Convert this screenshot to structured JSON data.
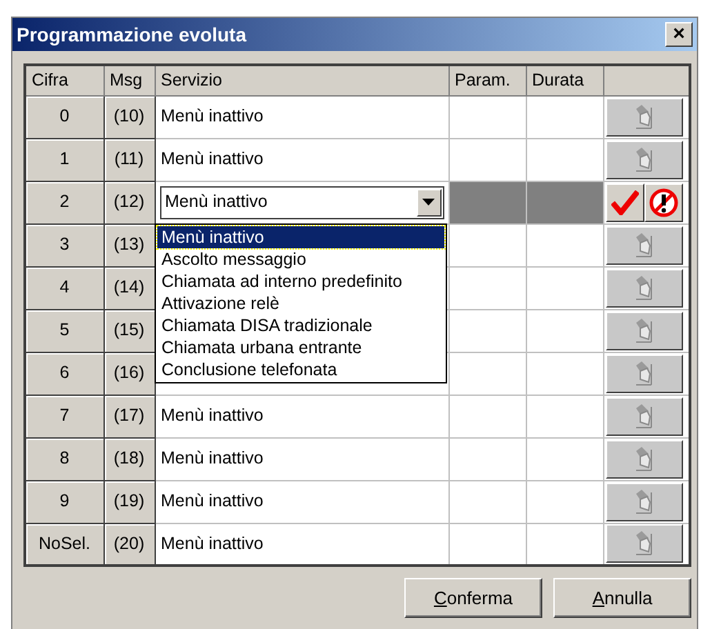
{
  "window": {
    "title": "Programmazione evoluta",
    "close": "×"
  },
  "table": {
    "columns": [
      "Cifra",
      "Msg",
      "Servizio",
      "Param.",
      "Durata"
    ],
    "rows": [
      {
        "cifra": "0",
        "msg": "(10)",
        "servizio": "Menù inattivo",
        "editing": false
      },
      {
        "cifra": "1",
        "msg": "(11)",
        "servizio": "Menù inattivo",
        "editing": false
      },
      {
        "cifra": "2",
        "msg": "(12)",
        "servizio": "Menù inattivo",
        "editing": true
      },
      {
        "cifra": "3",
        "msg": "(13)",
        "editing": false
      },
      {
        "cifra": "4",
        "msg": "(14)",
        "editing": false
      },
      {
        "cifra": "5",
        "msg": "(15)",
        "editing": false
      },
      {
        "cifra": "6",
        "msg": "(16)",
        "editing": false
      },
      {
        "cifra": "7",
        "msg": "(17)",
        "servizio": "Menù inattivo",
        "editing": false
      },
      {
        "cifra": "8",
        "msg": "(18)",
        "servizio": "Menù inattivo",
        "editing": false
      },
      {
        "cifra": "9",
        "msg": "(19)",
        "servizio": "Menù inattivo",
        "editing": false
      },
      {
        "cifra": "NoSel.",
        "msg": "(20)",
        "servizio": "Menù inattivo",
        "editing": false
      }
    ]
  },
  "dropdown": {
    "options": [
      {
        "label": "Menù inattivo",
        "selected": true
      },
      {
        "label": "Ascolto messaggio",
        "selected": false
      },
      {
        "label": "Chiamata ad interno predefinito",
        "selected": false
      },
      {
        "label": "Attivazione relè",
        "selected": false
      },
      {
        "label": "Chiamata DISA tradizionale",
        "selected": false
      },
      {
        "label": "Chiamata urbana entrante",
        "selected": false
      },
      {
        "label": "Conclusione telefonata",
        "selected": false
      }
    ]
  },
  "buttons": [
    {
      "label": "Conferma",
      "underline_first": true
    },
    {
      "label": "Annulla",
      "underline_first": true
    }
  ]
}
